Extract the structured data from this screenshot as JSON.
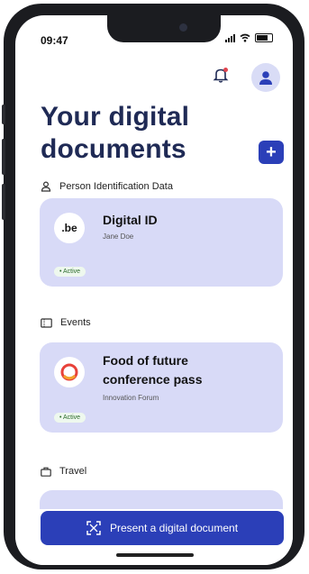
{
  "status_bar": {
    "time": "09:47"
  },
  "header": {
    "title_line1": "Your digital",
    "title_line2": "documents",
    "add_label": "+"
  },
  "sections": {
    "pid": {
      "label": "Person Identification Data"
    },
    "events": {
      "label": "Events"
    },
    "travel": {
      "label": "Travel"
    }
  },
  "cards": {
    "digital_id": {
      "logo_text": ".be",
      "title": "Digital ID",
      "subtitle": "Jane Doe",
      "badge": "• Active"
    },
    "conference": {
      "title_line1": "Food of future",
      "title_line2": "conference pass",
      "subtitle": "Innovation Forum",
      "badge": "• Active"
    }
  },
  "bottom_button": {
    "label": "Present a digital document"
  },
  "colors": {
    "primary": "#2b3fb8",
    "card_bg": "#d8daf7",
    "title_text": "#1f2a55",
    "active_badge_text": "#2c6b2c"
  },
  "icons": {
    "notifications": "bell-icon",
    "profile": "user-icon",
    "pid_section": "person-icon",
    "events_section": "ticket-icon",
    "travel_section": "suitcase-icon",
    "present": "scan-icon"
  }
}
